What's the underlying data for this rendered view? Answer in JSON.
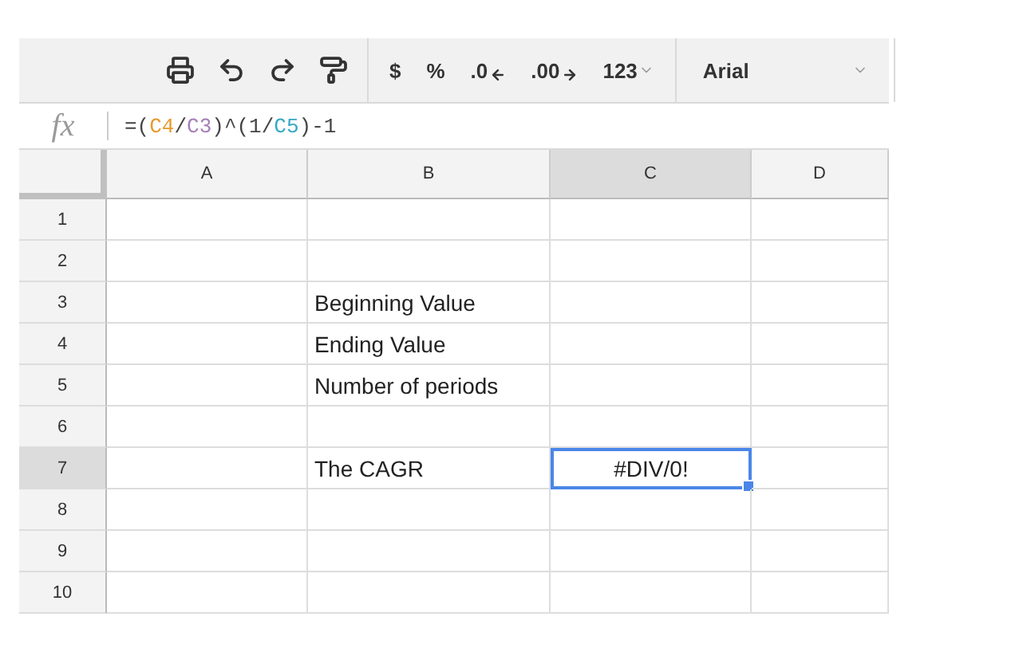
{
  "toolbar": {
    "icons": [
      {
        "kind": "print"
      },
      {
        "kind": "undo"
      },
      {
        "kind": "redo"
      },
      {
        "kind": "paint"
      }
    ],
    "format_buttons": [
      {
        "label": "$",
        "kind": "plain"
      },
      {
        "label": "%",
        "kind": "plain"
      },
      {
        "label": ".0",
        "kind": "decrease"
      },
      {
        "label": ".00",
        "kind": "increase"
      },
      {
        "label": "123",
        "kind": "menu"
      }
    ],
    "font": "Arial"
  },
  "formula_bar": {
    "label": "fx",
    "tokens": [
      {
        "text": "=(",
        "color": "#444444"
      },
      {
        "text": "C4",
        "color": "#e69a2e"
      },
      {
        "text": "/",
        "color": "#444444"
      },
      {
        "text": "C3",
        "color": "#a580b8"
      },
      {
        "text": ")^(1/",
        "color": "#444444"
      },
      {
        "text": "C5",
        "color": "#35a8c4"
      },
      {
        "text": ")-1",
        "color": "#444444"
      }
    ]
  },
  "columns": [
    {
      "label": "A",
      "selected": false
    },
    {
      "label": "B",
      "selected": false
    },
    {
      "label": "C",
      "selected": true
    },
    {
      "label": "D",
      "selected": false
    }
  ],
  "rows": [
    {
      "label": "1",
      "selected": false,
      "cells": [
        {
          "kind": "empty",
          "selected": false
        },
        {
          "kind": "empty",
          "selected": false
        },
        {
          "kind": "empty",
          "selected": false
        },
        {
          "kind": "empty",
          "selected": false
        }
      ]
    },
    {
      "label": "2",
      "selected": false,
      "cells": [
        {
          "kind": "empty",
          "selected": false
        },
        {
          "kind": "empty",
          "selected": false
        },
        {
          "kind": "empty",
          "selected": false
        },
        {
          "kind": "empty",
          "selected": false
        }
      ]
    },
    {
      "label": "3",
      "selected": false,
      "cells": [
        {
          "kind": "empty",
          "selected": false
        },
        {
          "kind": "text",
          "text": "Beginning Value",
          "selected": false
        },
        {
          "kind": "empty",
          "selected": false
        },
        {
          "kind": "empty",
          "selected": false
        }
      ]
    },
    {
      "label": "4",
      "selected": false,
      "cells": [
        {
          "kind": "empty",
          "selected": false
        },
        {
          "kind": "text",
          "text": "Ending Value",
          "selected": false
        },
        {
          "kind": "empty",
          "selected": false
        },
        {
          "kind": "empty",
          "selected": false
        }
      ]
    },
    {
      "label": "5",
      "selected": false,
      "cells": [
        {
          "kind": "empty",
          "selected": false
        },
        {
          "kind": "text",
          "text": "Number of periods",
          "selected": false
        },
        {
          "kind": "empty",
          "selected": false
        },
        {
          "kind": "empty",
          "selected": false
        }
      ]
    },
    {
      "label": "6",
      "selected": false,
      "cells": [
        {
          "kind": "empty",
          "selected": false
        },
        {
          "kind": "empty",
          "selected": false
        },
        {
          "kind": "empty",
          "selected": false
        },
        {
          "kind": "empty",
          "selected": false
        }
      ]
    },
    {
      "label": "7",
      "selected": true,
      "cells": [
        {
          "kind": "empty",
          "selected": false
        },
        {
          "kind": "text",
          "text": "The CAGR",
          "selected": false
        },
        {
          "kind": "error",
          "text": "#DIV/0!",
          "selected": true
        },
        {
          "kind": "empty",
          "selected": false
        }
      ]
    },
    {
      "label": "8",
      "selected": false,
      "cells": [
        {
          "kind": "empty",
          "selected": false
        },
        {
          "kind": "empty",
          "selected": false
        },
        {
          "kind": "empty",
          "selected": false
        },
        {
          "kind": "empty",
          "selected": false
        }
      ]
    },
    {
      "label": "9",
      "selected": false,
      "cells": [
        {
          "kind": "empty",
          "selected": false
        },
        {
          "kind": "empty",
          "selected": false
        },
        {
          "kind": "empty",
          "selected": false
        },
        {
          "kind": "empty",
          "selected": false
        }
      ]
    },
    {
      "label": "10",
      "selected": false,
      "cells": [
        {
          "kind": "empty",
          "selected": false
        },
        {
          "kind": "empty",
          "selected": false
        },
        {
          "kind": "empty",
          "selected": false
        },
        {
          "kind": "empty",
          "selected": false
        }
      ]
    }
  ]
}
